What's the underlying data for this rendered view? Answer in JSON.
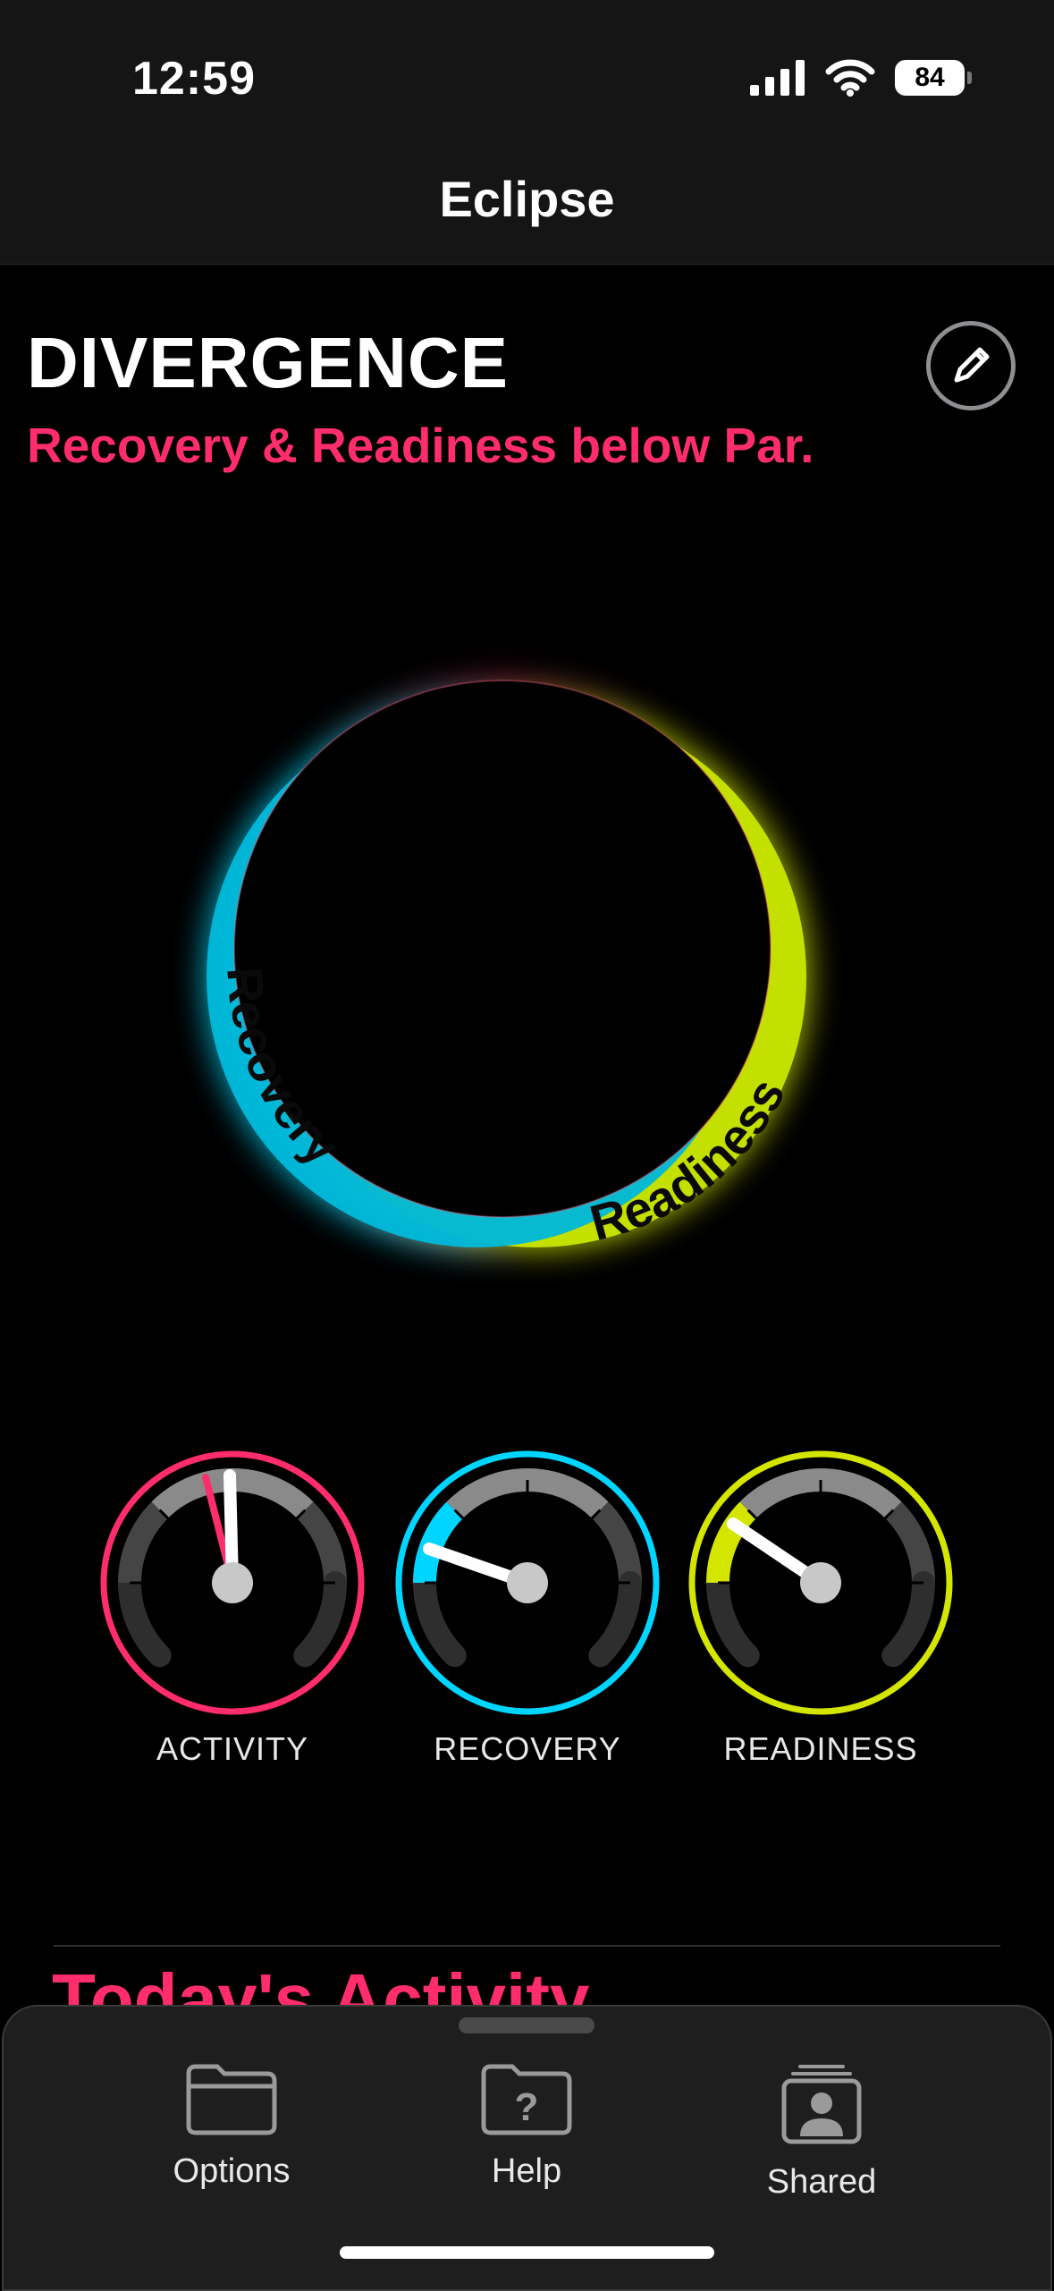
{
  "status_bar": {
    "time": "12:59",
    "battery_level": "84",
    "icons": [
      "signal-icon",
      "wifi-icon",
      "battery-icon"
    ]
  },
  "nav": {
    "title": "Eclipse"
  },
  "header": {
    "title": "DIVERGENCE",
    "subtitle": "Recovery & Readiness below Par.",
    "edit_icon": "pencil-icon"
  },
  "eclipse": {
    "recovery_label": "Recovery",
    "readiness_label": "Readiness"
  },
  "gauges": [
    {
      "label": "ACTIVITY",
      "color": "#ff2d6b"
    },
    {
      "label": "RECOVERY",
      "color": "#00d5ff"
    },
    {
      "label": "READINESS",
      "color": "#d4e600"
    }
  ],
  "section": {
    "title": "Today's Activity"
  },
  "tabs": [
    {
      "label": "Options",
      "icon": "folder-icon"
    },
    {
      "label": "Help",
      "icon": "help-folder-icon"
    },
    {
      "label": "Shared",
      "icon": "shared-contacts-icon"
    }
  ],
  "colors": {
    "accent": "#ff2d6b",
    "recovery": "#00c8ea",
    "readiness": "#d4e600"
  }
}
